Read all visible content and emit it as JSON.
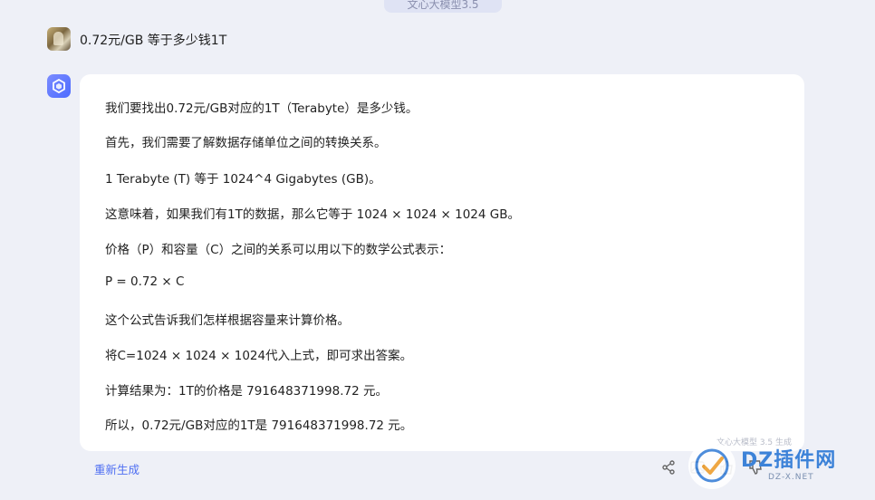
{
  "header": {
    "model_pill": "文心大模型3.5"
  },
  "user_message": {
    "text": "0.72元/GB 等于多少钱1T"
  },
  "answer": {
    "lines": [
      "我们要找出0.72元/GB对应的1T（Terabyte）是多少钱。",
      "首先，我们需要了解数据存储单位之间的转换关系。",
      "1 Terabyte (T) 等于 1024^4 Gigabytes (GB)。",
      "这意味着，如果我们有1T的数据，那么它等于 1024 × 1024 × 1024 GB。",
      "价格（P）和容量（C）之间的关系可以用以下的数学公式表示：",
      "P = 0.72 × C",
      "这个公式告诉我们怎样根据容量来计算价格。",
      "将C=1024 × 1024 × 1024代入上式，即可求出答案。",
      "计算结果为：1T的价格是 791648371998.72 元。",
      "所以，0.72元/GB对应的1T是 791648371998.72 元。"
    ],
    "generated_by": "文心大模型 3.5 生成"
  },
  "actions": {
    "regenerate_label": "重新生成"
  },
  "watermark": {
    "main": "DZ插件网",
    "sub": "DZ-X.NET"
  },
  "colors": {
    "accent": "#4e6ef2",
    "background": "#eef0f7",
    "card": "#ffffff"
  },
  "icons": [
    "share-icon",
    "image-icon",
    "thumbs-up-icon",
    "thumbs-down-icon"
  ]
}
